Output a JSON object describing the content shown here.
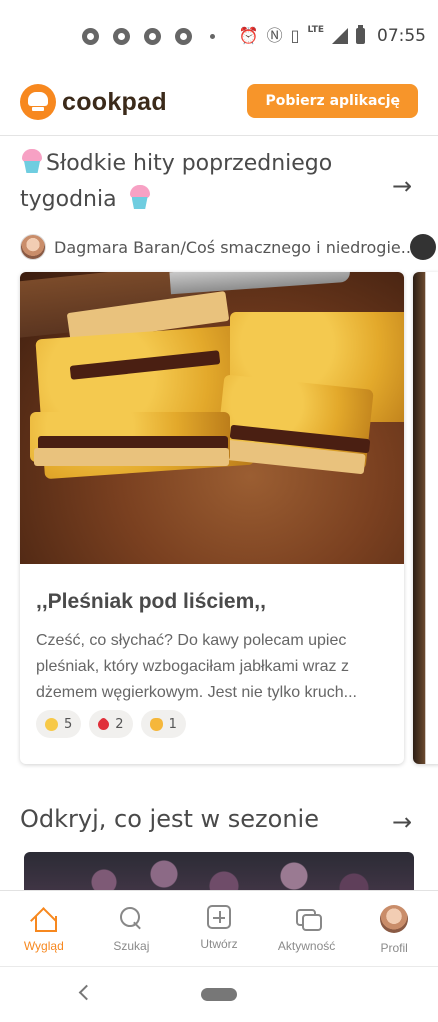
{
  "status_bar": {
    "time": "07:55",
    "network": "LTE",
    "icons": [
      "chrome-icon",
      "chrome-icon",
      "chrome-icon",
      "chrome-icon",
      "dot-icon",
      "alarm-icon",
      "nfc-icon",
      "vibrate-icon",
      "signal-icon",
      "battery-icon"
    ]
  },
  "header": {
    "logo_text": "cookpad",
    "get_app_label": "Pobierz aplikację",
    "brand_color": "#f7881f"
  },
  "section_weekly": {
    "title_line1": "Słodkie hity poprzedniego",
    "title_line2": "tygodnia",
    "arrow": "→",
    "author_name": "Dagmara Baran/Coś smacznego i niedrogie...",
    "card": {
      "title": ",,Pleśniak pod liściem,,",
      "description": "Cześć, co słychać? Do kawy polecam upiec pleśniak, który wzbogaciłam jabłkami wraz z dżemem węgierkowym. Jest nie tylko kruch...",
      "reactions": [
        {
          "icon": "yum-emoji-icon",
          "count": "5"
        },
        {
          "icon": "heart-emoji-icon",
          "count": "2"
        },
        {
          "icon": "clap-emoji-icon",
          "count": "1"
        }
      ]
    }
  },
  "section_season": {
    "title": "Odkryj, co jest w sezonie",
    "arrow": "→"
  },
  "bottom_nav": {
    "items": [
      {
        "label": "Wygląd",
        "icon": "home-icon",
        "active": true
      },
      {
        "label": "Szukaj",
        "icon": "search-icon",
        "active": false
      },
      {
        "label": "Utwórz",
        "icon": "create-icon",
        "active": false
      },
      {
        "label": "Aktywność",
        "icon": "activity-icon",
        "active": false
      },
      {
        "label": "Profil",
        "icon": "profile-avatar-icon",
        "active": false
      }
    ]
  }
}
